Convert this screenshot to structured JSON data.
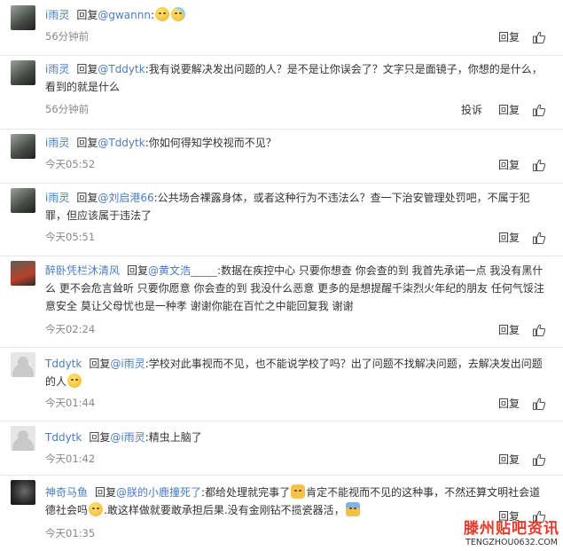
{
  "comments": [
    {
      "user": "i雨灵",
      "reply_prefix": "回复",
      "mention": "@gwannn",
      "text": ":",
      "text_after": "",
      "emojis": [
        "sleepy-face",
        "crying-face"
      ],
      "time": "56分钟前",
      "actions": [
        "回复"
      ]
    },
    {
      "user": "i雨灵",
      "reply_prefix": "回复",
      "mention": "@Tddytk",
      "text": ":我有说要解决发出问题的人？是不是让你误会了？文字只是面镜子，你想的是什么，看到的就是什么",
      "time": "56分钟前",
      "actions": [
        "投诉",
        "回复"
      ]
    },
    {
      "user": "i雨灵",
      "reply_prefix": "回复",
      "mention": "@Tddytk",
      "text": ":你如何得知学校视而不见？",
      "time": "今天05:52",
      "actions": [
        "回复"
      ]
    },
    {
      "user": "i雨灵",
      "reply_prefix": "回复",
      "mention": "@刘启港66",
      "text": ":公共场合裸露身体，或者这种行为不违法么？查一下治安管理处罚吧，不属于犯罪，但应该属于违法了",
      "time": "今天05:51",
      "actions": [
        "回复"
      ]
    },
    {
      "user": "醉卧凭栏沐清风",
      "reply_prefix": "回复",
      "mention": "@黄文浩_____",
      "text": ":数据在疾控中心 只要你想查 你会查的到 我首先承诺一点 我没有黑什么 更不会危言耸听 只要你愿意 你会查的到 我没什么恶意 更多的是想提醒千柒烈火年纪的朋友 任何气馁注意安全 莫让父母忧也是一种孝 谢谢你能在百忙之中能回复我 谢谢",
      "time": "今天02:24",
      "actions": [
        "回复"
      ]
    },
    {
      "user": "Tddytk",
      "reply_prefix": "回复",
      "mention": "@i雨灵",
      "text": ":学校对此事视而不见，也不能说学校了吗？出了问题不找解决问题，去解决发出问题的人",
      "emoji_after": "embarrassed-face",
      "time": "今天01:44",
      "actions": [
        "回复"
      ]
    },
    {
      "user": "Tddytk",
      "reply_prefix": "回复",
      "mention": "@i雨灵",
      "text": ":精虫上脑了",
      "time": "今天01:42",
      "actions": [
        "回复"
      ]
    },
    {
      "user": "神奇马鱼",
      "reply_prefix": "回复",
      "mention": "@朕的小鹿撞死了",
      "text_a": ":都给处理就完事了",
      "text_b": "肯定不能视而不见的这种事，不然还算文明社会道德社会吗",
      "text_c": ".敢这样做就要敢承担后果.没有金刚钻不揽瓷器活，",
      "time": "今天01:35",
      "actions": [
        "回复"
      ]
    }
  ],
  "watermark": {
    "title": "滕州贴吧资讯",
    "url": "TENGZHOU0632.COM"
  },
  "colors": {
    "link": "#4a7dbf",
    "text": "#333333",
    "time": "#888888",
    "divider": "#e8e8e8",
    "watermark": "#e23a2c"
  },
  "icons": {
    "like": "thumbs-up-icon"
  }
}
